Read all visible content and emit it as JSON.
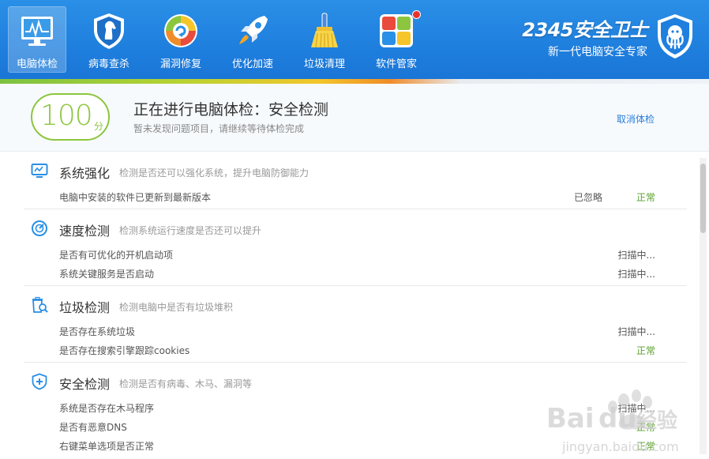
{
  "colors": {
    "top_bar": "#1f7fde",
    "score_green": "#8cc63f",
    "ok_green": "#5aa02c",
    "link_blue": "#2a7ed8"
  },
  "nav": [
    {
      "label": "电脑体检",
      "icon": "monitor-chart-icon",
      "active": true
    },
    {
      "label": "病毒查杀",
      "icon": "horse-shield-icon"
    },
    {
      "label": "漏洞修复",
      "icon": "color-disc-icon"
    },
    {
      "label": "优化加速",
      "icon": "rocket-icon"
    },
    {
      "label": "垃圾清理",
      "icon": "broom-icon"
    },
    {
      "label": "软件管家",
      "icon": "software-grid-icon",
      "badge": "notification-dot"
    }
  ],
  "brand": {
    "name": "2345安全卫士",
    "slogan": "新一代电脑安全专家",
    "logo": "shield-logo-icon"
  },
  "status": {
    "score": "100",
    "score_unit": "分",
    "title": "正在进行电脑体检：安全检测",
    "subtitle": "暂未发现问题项目，请继续等待体检完成",
    "cancel_label": "取消体检"
  },
  "sections": [
    {
      "title": "系统强化",
      "desc": "检测是否还可以强化系统，提升电脑防御能力",
      "icon": "monitor-icon",
      "rows": [
        {
          "label": "电脑中安装的软件已更新到最新版本",
          "ignored": "已忽略",
          "status": "正常"
        }
      ]
    },
    {
      "title": "速度检测",
      "desc": "检测系统运行速度是否还可以提升",
      "icon": "speedometer-icon",
      "rows": [
        {
          "label": "是否有可优化的开机启动项",
          "status": "扫描中..."
        },
        {
          "label": "系统关键服务是否启动",
          "status": "扫描中..."
        }
      ]
    },
    {
      "title": "垃圾检测",
      "desc": "检测电脑中是否有垃圾堆积",
      "icon": "trash-search-icon",
      "rows": [
        {
          "label": "是否存在系统垃圾",
          "status": "扫描中..."
        },
        {
          "label": "是否存在搜索引擎跟踪cookies",
          "status": "正常"
        }
      ]
    },
    {
      "title": "安全检测",
      "desc": "检测是否有病毒、木马、漏洞等",
      "icon": "shield-plus-icon",
      "rows": [
        {
          "label": "系统是否存在木马程序",
          "status": "扫描中..."
        },
        {
          "label": "是否有恶意DNS",
          "status": "正常"
        },
        {
          "label": "右键菜单选项是否正常",
          "status": "正常"
        }
      ]
    }
  ],
  "watermark": {
    "brand": "Baidu经验",
    "url": "jingyan.baidu.com"
  }
}
